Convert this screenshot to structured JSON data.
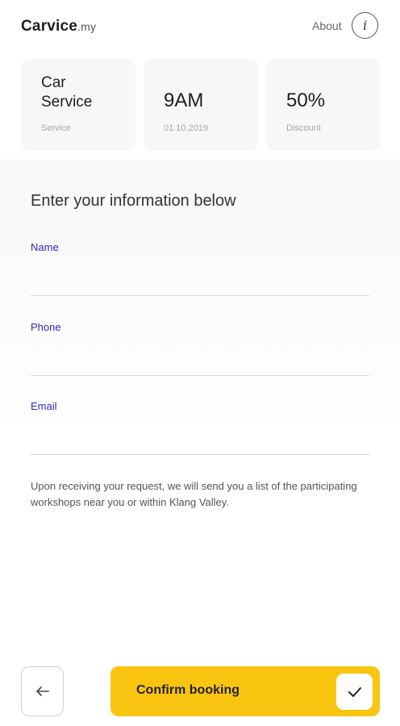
{
  "header": {
    "brand": "Carvice",
    "brand_tld": ".my",
    "about_label": "About",
    "info_glyph": "i"
  },
  "summary_cards": [
    {
      "title_line1": "Car",
      "title_line2": "Service",
      "subtitle": "Service"
    },
    {
      "value": "9AM",
      "subtitle": "01.10.2019"
    },
    {
      "value": "50%",
      "subtitle": "Discount"
    }
  ],
  "form": {
    "heading": "Enter your information below",
    "fields": [
      {
        "label": "Name",
        "value": ""
      },
      {
        "label": "Phone",
        "value": ""
      },
      {
        "label": "Email",
        "value": ""
      }
    ],
    "note": "Upon receiving your request, we will send you a list of the participating workshops near you or within Klang Valley."
  },
  "footer": {
    "back_icon": "arrow-left-icon",
    "confirm_label": "Confirm booking",
    "confirm_icon": "checkmark-icon",
    "accent_color": "#f9c511",
    "label_color": "#2b2bbf"
  }
}
